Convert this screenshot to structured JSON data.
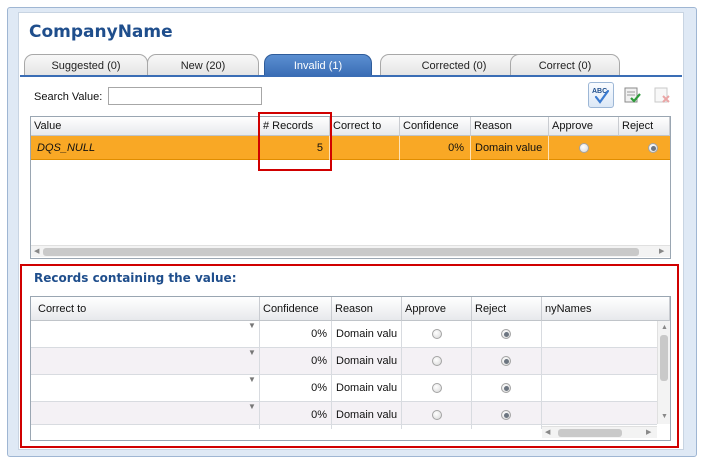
{
  "app": {
    "title": "CompanyName"
  },
  "tabs": [
    {
      "label": "Suggested (0)"
    },
    {
      "label": "New (20)"
    },
    {
      "label": "Invalid (1)",
      "active": true
    },
    {
      "label": "Corrected (0)"
    },
    {
      "label": "Correct (0)"
    }
  ],
  "search": {
    "label": "Search Value:",
    "value": "",
    "placeholder": ""
  },
  "toolbar": {
    "icons": [
      "spell-check-icon",
      "approve-all-icon",
      "reject-all-icon"
    ]
  },
  "top_grid": {
    "columns": [
      "Value",
      "# Records",
      "Correct to",
      "Confidence",
      "Reason",
      "Approve",
      "Reject"
    ],
    "rows": [
      {
        "value": "DQS_NULL",
        "records": "5",
        "correct_to": "",
        "confidence": "0%",
        "reason": "Domain value",
        "approve": false,
        "reject": true
      }
    ]
  },
  "records": {
    "title": "Records containing the value:",
    "columns": [
      "Correct to",
      "Confidence",
      "Reason",
      "Approve",
      "Reject",
      "nyNames"
    ],
    "rows": [
      {
        "correct_to": "",
        "confidence": "0%",
        "reason": "Domain valu",
        "approve": false,
        "reject": true
      },
      {
        "correct_to": "",
        "confidence": "0%",
        "reason": "Domain valu",
        "approve": false,
        "reject": true
      },
      {
        "correct_to": "",
        "confidence": "0%",
        "reason": "Domain valu",
        "approve": false,
        "reject": true
      },
      {
        "correct_to": "",
        "confidence": "0%",
        "reason": "Domain valu",
        "approve": false,
        "reject": true
      }
    ]
  },
  "colors": {
    "accent": "#1f4e8c",
    "selected_row": "#f9a825",
    "active_tab": "#3a6db5",
    "highlight": "#d00000"
  }
}
